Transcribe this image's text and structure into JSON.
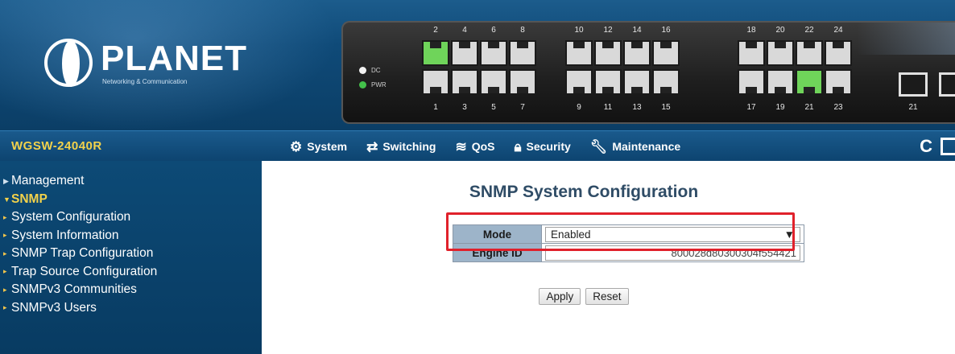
{
  "brand": {
    "logo_word": "PLANET",
    "logo_sub": "Networking & Communication",
    "model": "WGSW-24040R"
  },
  "device": {
    "led_dc": "DC",
    "led_pwr": "PWR",
    "top_ports": [
      "2",
      "4",
      "6",
      "8",
      "10",
      "12",
      "14",
      "16",
      "18",
      "20",
      "22",
      "24"
    ],
    "bottom_ports": [
      "1",
      "3",
      "5",
      "7",
      "9",
      "11",
      "13",
      "15",
      "17",
      "19",
      "21",
      "23"
    ],
    "sfp_label": "21",
    "active_ports": [
      "2",
      "21"
    ]
  },
  "nav": {
    "items": [
      {
        "label": "System",
        "icon": "gear-icon"
      },
      {
        "label": "Switching",
        "icon": "switching-icon"
      },
      {
        "label": "QoS",
        "icon": "qos-icon"
      },
      {
        "label": "Security",
        "icon": "lock-icon"
      },
      {
        "label": "Maintenance",
        "icon": "wrench-icon"
      }
    ]
  },
  "sidebar": {
    "items": [
      {
        "label": "Management"
      },
      {
        "label": "SNMP"
      },
      {
        "label": "System Configuration"
      },
      {
        "label": "System Information"
      },
      {
        "label": "SNMP Trap Configuration"
      },
      {
        "label": "Trap Source Configuration"
      },
      {
        "label": "SNMPv3 Communities"
      },
      {
        "label": "SNMPv3 Users"
      }
    ]
  },
  "main": {
    "title": "SNMP System Configuration",
    "mode_label": "Mode",
    "mode_value": "Enabled",
    "engine_label": "Engine ID",
    "engine_value": "800028d80300304f554421",
    "apply_label": "Apply",
    "reset_label": "Reset"
  },
  "colors": {
    "header_blue": "#0f4a78",
    "model_yellow": "#f2d24b",
    "highlight_red": "#e0212b",
    "label_blue": "#9db4c9",
    "port_active": "#6fd45a"
  }
}
